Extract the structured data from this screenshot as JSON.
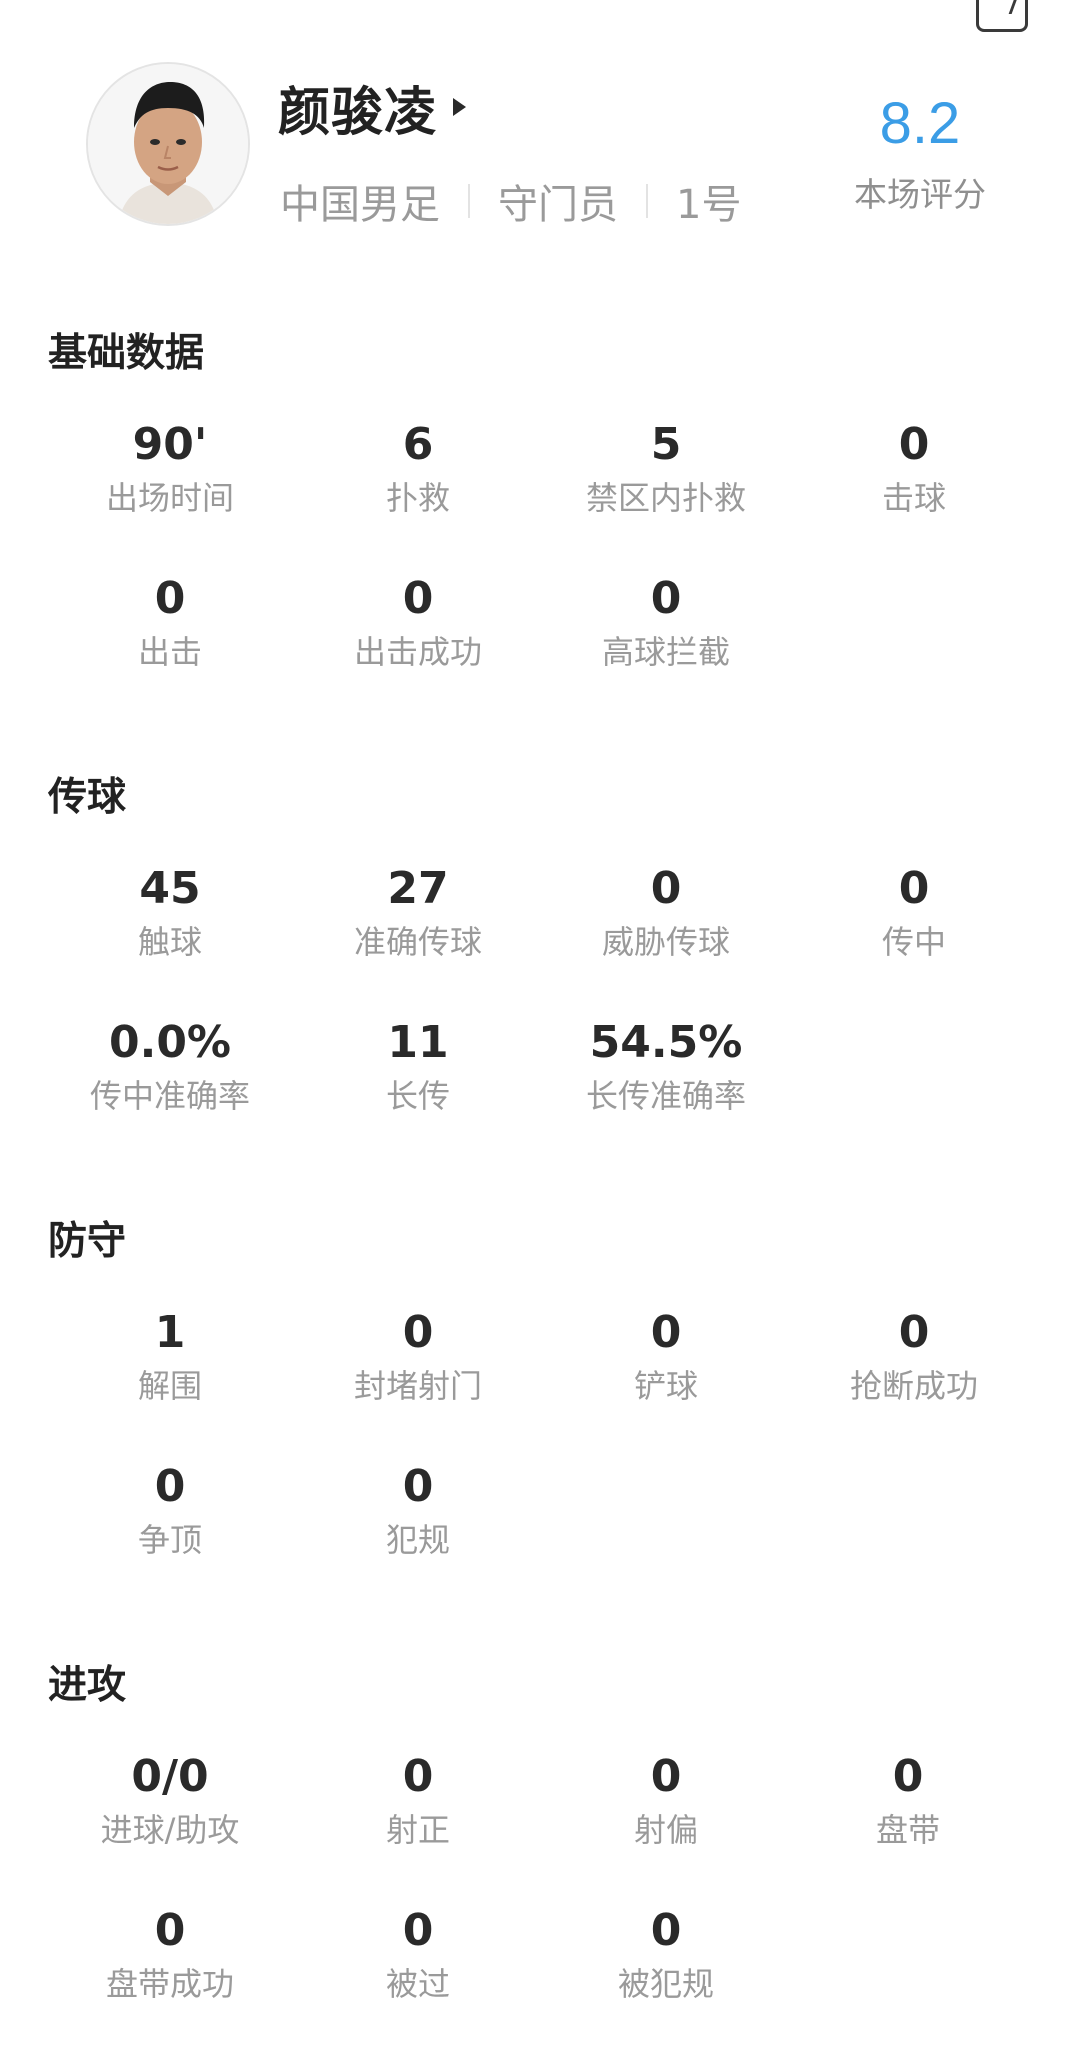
{
  "header": {
    "player_name": "颜骏凌",
    "team": "中国男足",
    "position": "守门员",
    "number": "1号",
    "rating_value": "8.2",
    "rating_label": "本场评分"
  },
  "colors": {
    "rating": "#3b9de6"
  },
  "sections": [
    {
      "title": "基础数据",
      "stats": [
        {
          "value": "90'",
          "label": "出场时间"
        },
        {
          "value": "6",
          "label": "扑救"
        },
        {
          "value": "5",
          "label": "禁区内扑救"
        },
        {
          "value": "0",
          "label": "击球"
        },
        {
          "value": "0",
          "label": "出击"
        },
        {
          "value": "0",
          "label": "出击成功"
        },
        {
          "value": "0",
          "label": "高球拦截"
        }
      ]
    },
    {
      "title": "传球",
      "stats": [
        {
          "value": "45",
          "label": "触球"
        },
        {
          "value": "27",
          "label": "准确传球"
        },
        {
          "value": "0",
          "label": "威胁传球"
        },
        {
          "value": "0",
          "label": "传中"
        },
        {
          "value": "0.0%",
          "label": "传中准确率"
        },
        {
          "value": "11",
          "label": "长传"
        },
        {
          "value": "54.5%",
          "label": "长传准确率"
        }
      ]
    },
    {
      "title": "防守",
      "stats": [
        {
          "value": "1",
          "label": "解围"
        },
        {
          "value": "0",
          "label": "封堵射门"
        },
        {
          "value": "0",
          "label": "铲球"
        },
        {
          "value": "0",
          "label": "抢断成功"
        },
        {
          "value": "0",
          "label": "争顶"
        },
        {
          "value": "0",
          "label": "犯规"
        }
      ]
    },
    {
      "title": "进攻",
      "stats": [
        {
          "value": "0/0",
          "label": "进球/助攻"
        },
        {
          "value": "0",
          "label": "射正"
        },
        {
          "value": "0",
          "label": "射偏"
        },
        {
          "value": "0",
          "label": "盘带"
        },
        {
          "value": "0",
          "label": "盘带成功"
        },
        {
          "value": "0",
          "label": "被过"
        },
        {
          "value": "0",
          "label": "被犯规"
        }
      ]
    }
  ]
}
